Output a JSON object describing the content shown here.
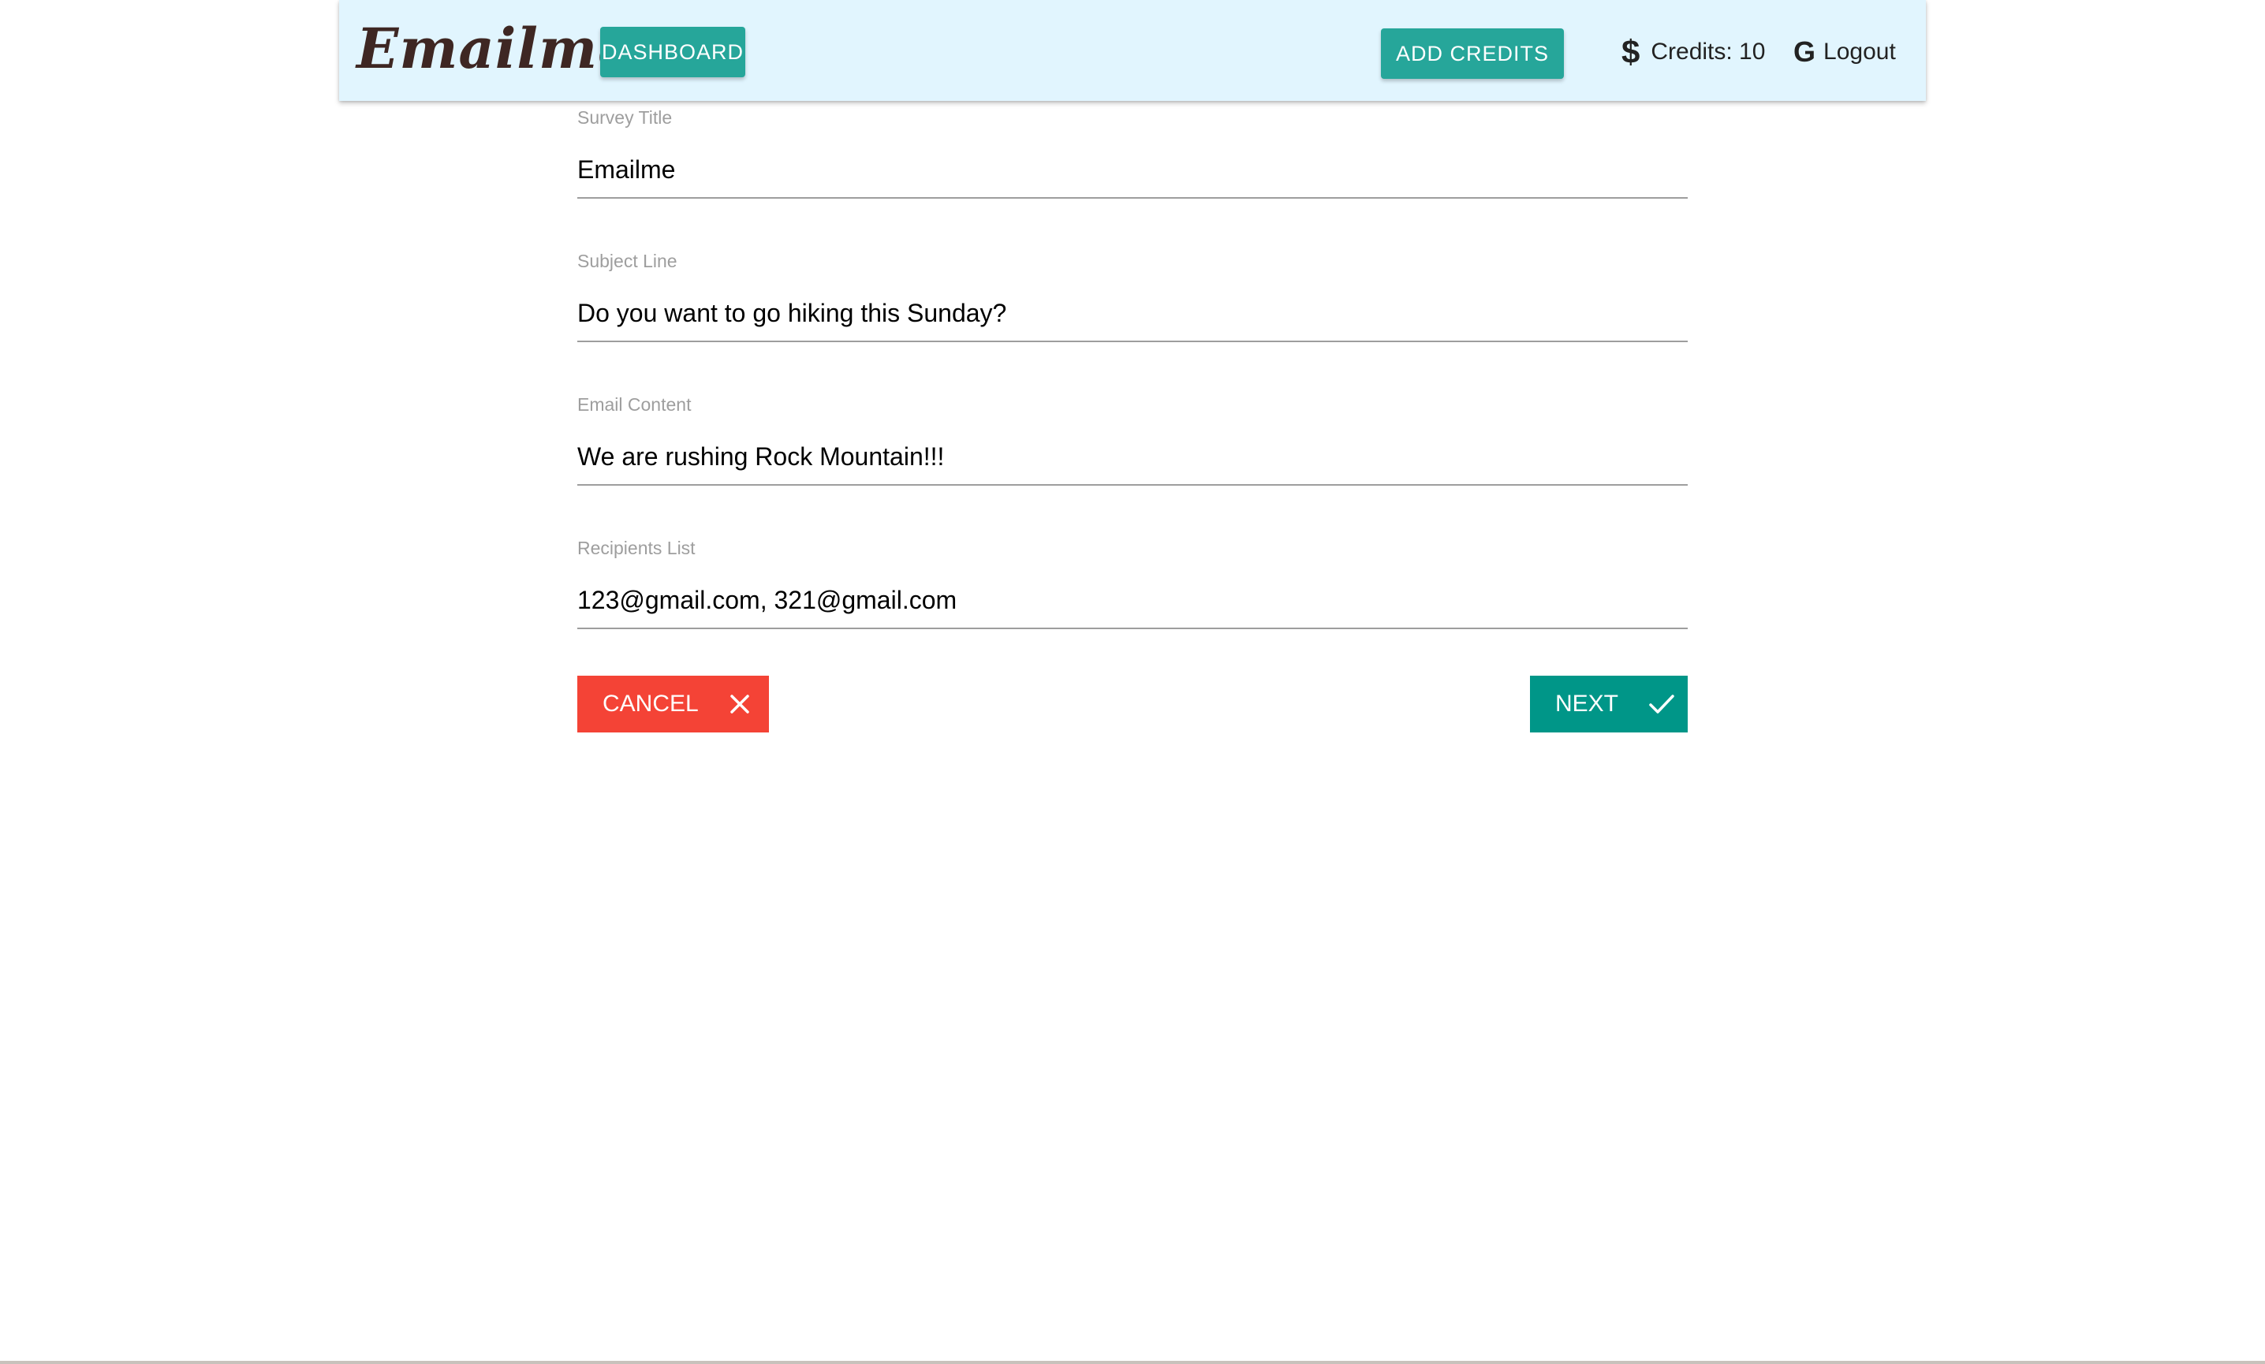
{
  "navbar": {
    "brand": "Emailme",
    "dashboard_label": "DASHBOARD",
    "add_credits_label": "ADD CREDITS",
    "credits_text": "Credits: 10",
    "credits_icon": "dollar-icon",
    "logout_label": "Logout",
    "logout_icon": "google-icon",
    "background_color": "#e1f5fe",
    "button_color": "#26a69a"
  },
  "form": {
    "fields": [
      {
        "label": "Survey Title",
        "value": "Emailme"
      },
      {
        "label": "Subject Line",
        "value": "Do you want to go hiking this Sunday?"
      },
      {
        "label": "Email Content",
        "value": "We are rushing Rock Mountain!!!"
      },
      {
        "label": "Recipients List",
        "value": "123@gmail.com, 321@gmail.com"
      }
    ],
    "cancel_label": "CANCEL",
    "cancel_icon": "close-icon",
    "cancel_color": "#f44336",
    "next_label": "NEXT",
    "next_icon": "check-icon",
    "next_color": "#009688"
  }
}
